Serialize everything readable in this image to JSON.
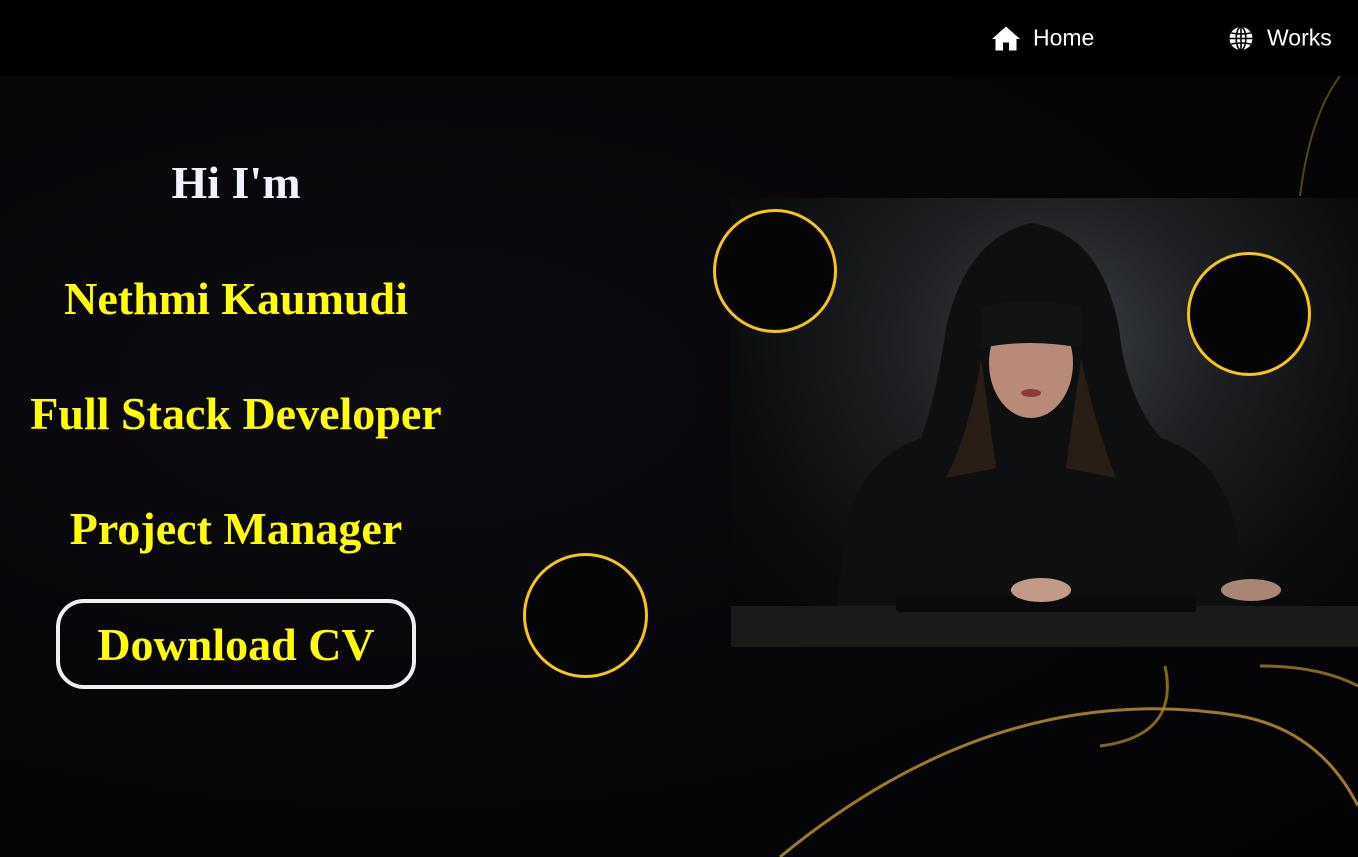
{
  "nav": {
    "home": {
      "label": "Home",
      "icon": "home-icon"
    },
    "works": {
      "label": "Works",
      "icon": "globe-icon"
    }
  },
  "hero": {
    "greeting": "Hi I'm",
    "name": "Nethmi Kaumudi",
    "roles": [
      "Full Stack Developer",
      "Project Manager"
    ],
    "cv_button": "Download CV"
  },
  "colors": {
    "background": "#000000",
    "accent_yellow": "#ffff00",
    "ring_gold": "#f5c518",
    "text_white": "#ffffff"
  }
}
